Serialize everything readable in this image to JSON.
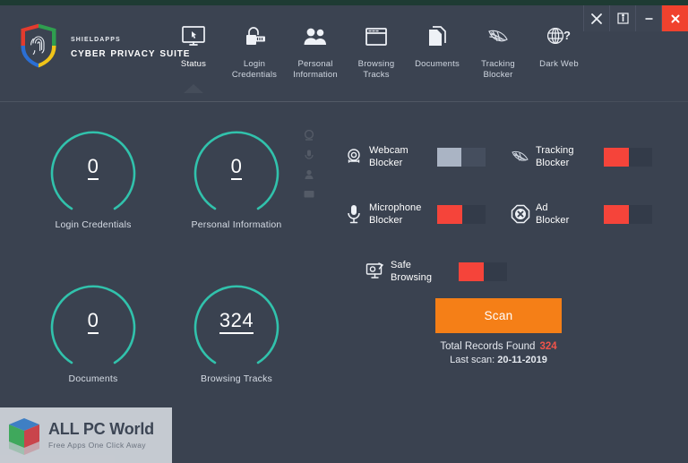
{
  "window": {
    "controls": [
      {
        "name": "tools-button",
        "glyph": "✖",
        "label": "Tools"
      },
      {
        "name": "info-button",
        "glyph": "ⓘ",
        "label": "Info"
      },
      {
        "name": "minimize-button",
        "glyph": "─",
        "label": "Minimize"
      },
      {
        "name": "close-button",
        "glyph": "✕",
        "label": "Close"
      }
    ]
  },
  "brand": {
    "line1": "ShieldApps",
    "line2": "Cyber Privacy Suite",
    "logo_icon": "shield-fingerprint-logo"
  },
  "nav": {
    "items": [
      {
        "label": "Status",
        "icon": "monitor-icon",
        "active": true
      },
      {
        "label": "Login\nCredentials",
        "icon": "padlock-keyboard-icon",
        "active": false
      },
      {
        "label": "Personal\nInformation",
        "icon": "people-icon",
        "active": false
      },
      {
        "label": "Browsing\nTracks",
        "icon": "browser-window-icon",
        "active": false
      },
      {
        "label": "Documents",
        "icon": "documents-icon",
        "active": false
      },
      {
        "label": "Tracking\nBlocker",
        "icon": "tracking-web-icon",
        "active": false
      },
      {
        "label": "Dark Web",
        "icon": "globe-question-icon",
        "active": false
      }
    ]
  },
  "gauges": [
    {
      "value": "0",
      "label": "Login Credentials"
    },
    {
      "value": "0",
      "label": "Personal Information"
    },
    {
      "value": "0",
      "label": "Documents"
    },
    {
      "value": "324",
      "label": "Browsing Tracks"
    }
  ],
  "toggles": [
    {
      "label": "Webcam\nBlocker",
      "icon": "webcam-icon",
      "state": "grey"
    },
    {
      "label": "Tracking\nBlocker",
      "icon": "tracking-web-icon",
      "state": "red"
    },
    {
      "label": "Microphone\nBlocker",
      "icon": "microphone-icon",
      "state": "red"
    },
    {
      "label": "Ad\nBlocker",
      "icon": "ad-block-icon",
      "state": "red"
    },
    {
      "label": "Safe\nBrowsing",
      "icon": "safe-browsing-icon",
      "state": "red"
    }
  ],
  "scan": {
    "button_label": "Scan",
    "records_label": "Total Records Found",
    "records_value": "324",
    "last_scan_label": "Last scan:",
    "last_scan_value": "20-11-2019"
  },
  "watermark": {
    "title": "ALL PC World",
    "tagline": "Free Apps One Click Away",
    "logo_icon": "cube-logo"
  },
  "colors": {
    "background": "#3a4250",
    "header": "#3b4351",
    "accent_teal": "#31c2ac",
    "scan_orange": "#f57f17",
    "toggle_red": "#f5443a",
    "toggle_grey": "#aab4c4",
    "close_red": "#f0422e"
  }
}
